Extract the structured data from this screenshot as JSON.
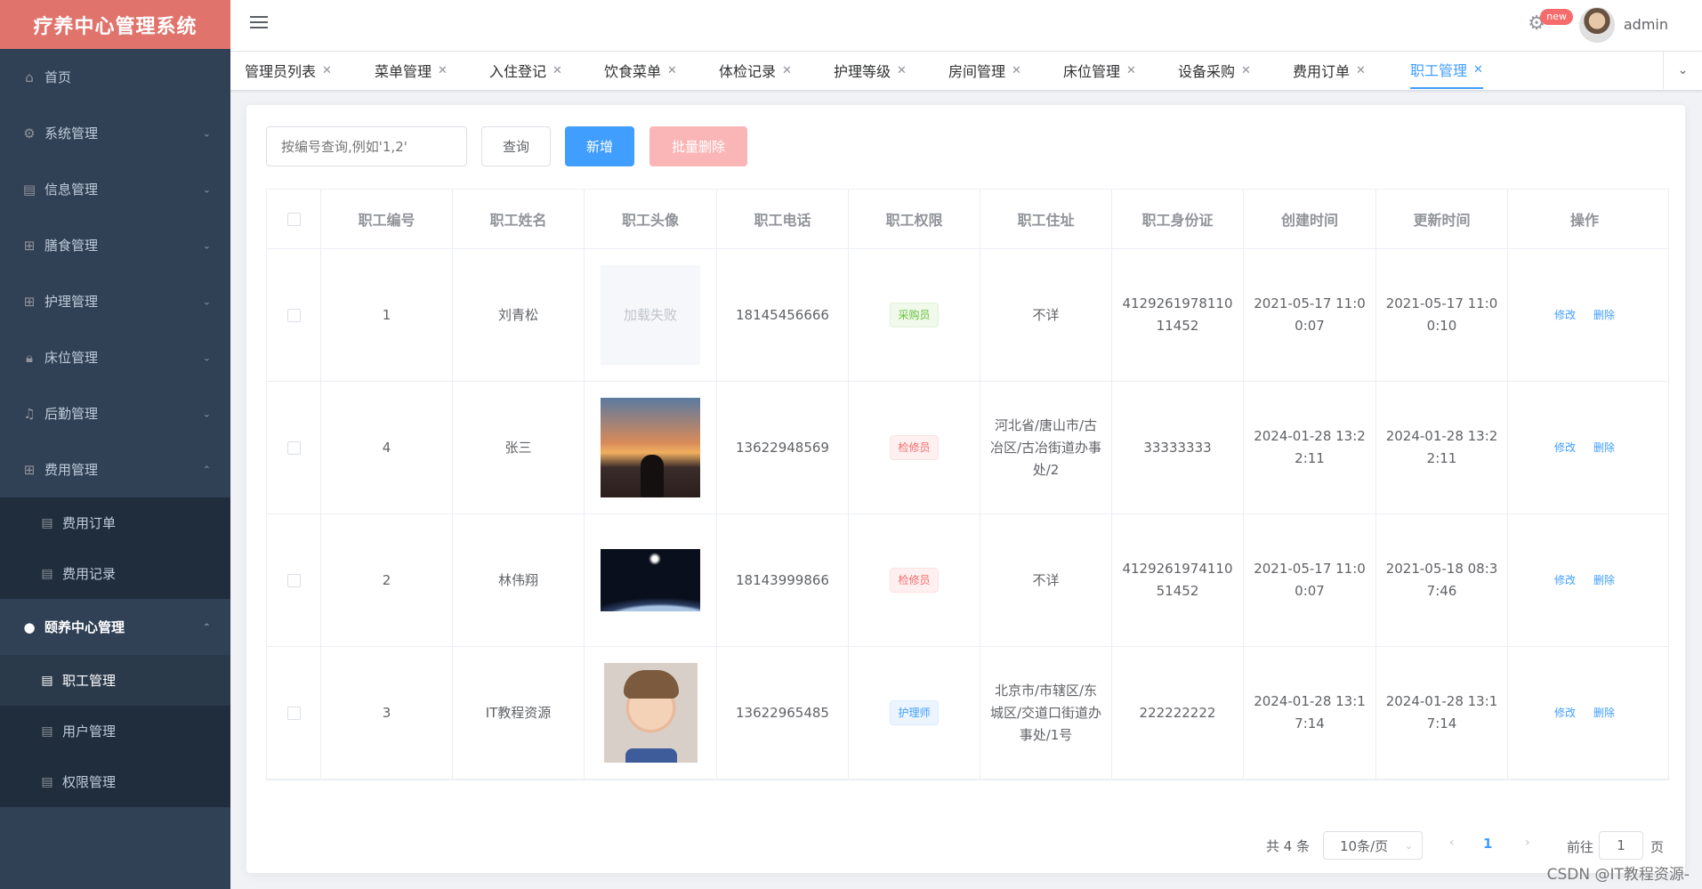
{
  "app": {
    "title": "疗养中心管理系统"
  },
  "sidebar": {
    "items": [
      {
        "label": "首页",
        "icon": "home-icon"
      },
      {
        "label": "系统管理",
        "icon": "gear-icon"
      },
      {
        "label": "信息管理",
        "icon": "document-icon"
      },
      {
        "label": "膳食管理",
        "icon": "grid-icon"
      },
      {
        "label": "护理管理",
        "icon": "grid-icon"
      },
      {
        "label": "床位管理",
        "icon": "lock-icon"
      },
      {
        "label": "后勤管理",
        "icon": "bell-icon"
      },
      {
        "label": "费用管理",
        "icon": "grid-icon"
      }
    ],
    "fee_sub": [
      "费用订单",
      "费用记录"
    ],
    "group2": {
      "label": "颐养中心管理",
      "icon": "user-icon"
    },
    "group2_sub": [
      "职工管理",
      "用户管理",
      "权限管理"
    ]
  },
  "header": {
    "badge": "new",
    "username": "admin"
  },
  "tabs": [
    "管理员列表",
    "菜单管理",
    "入住登记",
    "饮食菜单",
    "体检记录",
    "护理等级",
    "房间管理",
    "床位管理",
    "设备采购",
    "费用订单",
    "职工管理"
  ],
  "toolbar": {
    "search_placeholder": "按编号查询,例如'1,2'",
    "query": "查询",
    "add": "新增",
    "batch_delete": "批量删除"
  },
  "table": {
    "headers": [
      "职工编号",
      "职工姓名",
      "职工头像",
      "职工电话",
      "职工权限",
      "职工住址",
      "职工身份证",
      "创建时间",
      "更新时间",
      "操作"
    ],
    "rows": [
      {
        "id": "1",
        "name": "刘青松",
        "avatar_text": "加载失败",
        "phone": "18145456666",
        "role": "采购员",
        "address": "不详",
        "idcard": "412926197811011452",
        "created": "2021-05-17 11:00:07",
        "updated": "2021-05-17 11:00:10"
      },
      {
        "id": "4",
        "name": "张三",
        "avatar_text": "",
        "phone": "13622948569",
        "role": "检修员",
        "address": "河北省/唐山市/古冶区/古冶街道办事处/2",
        "idcard": "33333333",
        "created": "2024-01-28 13:22:11",
        "updated": "2024-01-28 13:22:11"
      },
      {
        "id": "2",
        "name": "林伟翔",
        "avatar_text": "",
        "phone": "18143999866",
        "role": "检修员",
        "address": "不详",
        "idcard": "412926197411051452",
        "created": "2021-05-17 11:00:07",
        "updated": "2021-05-18 08:37:46"
      },
      {
        "id": "3",
        "name": "IT教程资源",
        "avatar_text": "",
        "phone": "13622965485",
        "role": "护理师",
        "address": "北京市/市辖区/东城区/交道口街道办事处/1号",
        "idcard": "222222222",
        "created": "2024-01-28 13:17:14",
        "updated": "2024-01-28 13:17:14"
      }
    ],
    "edit": "修改",
    "delete": "删除"
  },
  "pagination": {
    "total": "共 4 条",
    "page_size": "10条/页",
    "current": "1",
    "goto": "前往",
    "goto_value": "1",
    "page_unit": "页"
  },
  "watermark": "CSDN @IT教程资源-",
  "colors": {
    "primary": "#409eff",
    "sidebar_bg": "#304156",
    "logo_bg": "#e0736c",
    "danger": "#f56c6c",
    "success": "#67c23a"
  }
}
